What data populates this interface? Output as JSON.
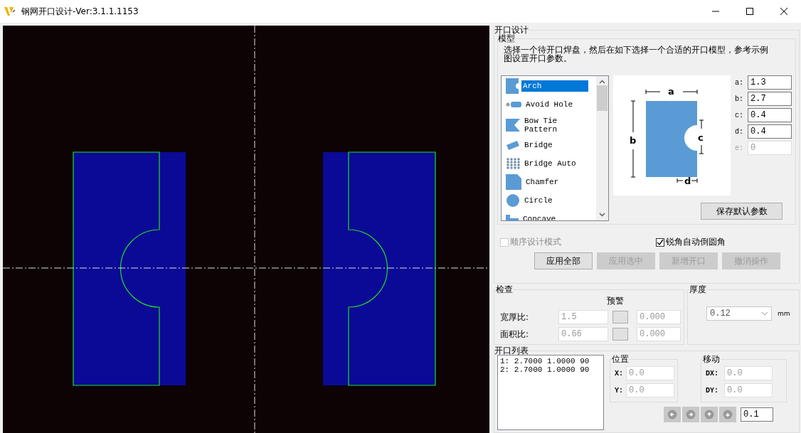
{
  "window": {
    "title": "钢网开口设计-Ver:3.1.1.1153"
  },
  "design": {
    "title": "开口设计",
    "model": {
      "title": "模型",
      "description": "选择一个待开口焊盘，然后在如下选择一个合适的开口模型，参考示例图设置开口参数。",
      "models": [
        {
          "label": "Arch",
          "kind": "arch",
          "selected": true
        },
        {
          "label": "Avoid Hole",
          "kind": "avoid",
          "selected": false
        },
        {
          "label": "Bow Tie Pattern",
          "kind": "bowtie",
          "selected": false
        },
        {
          "label": "Bridge",
          "kind": "bridge",
          "selected": false
        },
        {
          "label": "Bridge Auto",
          "kind": "dots",
          "selected": false
        },
        {
          "label": "Chamfer",
          "kind": "chamfer",
          "selected": false
        },
        {
          "label": "Circle",
          "kind": "circle",
          "selected": false
        },
        {
          "label": "Concave",
          "kind": "concave",
          "selected": false
        }
      ],
      "preview_labels": [
        "a",
        "b",
        "c",
        "d"
      ],
      "params": [
        {
          "label": "a:",
          "value": "1.3",
          "disabled": false
        },
        {
          "label": "b:",
          "value": "2.7",
          "disabled": false
        },
        {
          "label": "c:",
          "value": "0.4",
          "disabled": false
        },
        {
          "label": "d:",
          "value": "0.4",
          "disabled": false
        },
        {
          "label": "e:",
          "value": "0",
          "disabled": true
        }
      ],
      "save_button": "保存默认参数"
    },
    "options": [
      {
        "label": "顺序设计模式",
        "checked": false,
        "disabled": true
      },
      {
        "label": "锐角自动倒圆角",
        "checked": true,
        "disabled": false
      }
    ],
    "buttons": [
      {
        "label": "应用全部",
        "disabled": false
      },
      {
        "label": "应用选中",
        "disabled": true
      },
      {
        "label": "新增开口",
        "disabled": true
      },
      {
        "label": "撤消操作",
        "disabled": true
      }
    ]
  },
  "check": {
    "title": "检查",
    "warning_label": "预警",
    "rows": [
      {
        "label": "宽厚比:",
        "value": "1.5",
        "warn_value": "0.000"
      },
      {
        "label": "面积比:",
        "value": "0.66",
        "warn_value": "0.000"
      }
    ]
  },
  "thickness": {
    "title": "厚度",
    "value": "0.12",
    "unit": "mm"
  },
  "opening_list": {
    "title": "开口列表",
    "items": [
      "1: 2.7000 1.0000 90",
      "2: 2.7000 1.0000 90"
    ],
    "position": {
      "title": "位置",
      "fields": [
        {
          "label": "X:",
          "value": "0.0"
        },
        {
          "label": "Y:",
          "value": "0.0"
        }
      ]
    },
    "move": {
      "title": "移动",
      "fields": [
        {
          "label": "DX:",
          "value": "0.0"
        },
        {
          "label": "DY:",
          "value": "0.0"
        }
      ]
    },
    "step_value": "0.1"
  }
}
